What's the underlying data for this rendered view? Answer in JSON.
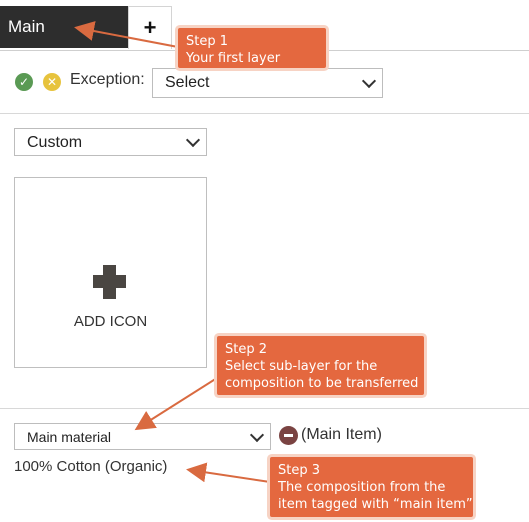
{
  "tabs": {
    "main_label": "Main",
    "add_label": "+"
  },
  "exception": {
    "label": "Exception:",
    "select_value": "Select"
  },
  "custom_select": {
    "value": "Custom"
  },
  "add_icon": {
    "label": "ADD ICON"
  },
  "material": {
    "select_value": "Main material",
    "main_item_label": "(Main Item)",
    "composition": "100% Cotton (Organic)"
  },
  "callouts": {
    "step1": {
      "title": "Step 1",
      "text": "Your first layer"
    },
    "step2": {
      "title": "Step 2",
      "line1": "Select sub-layer for the",
      "line2": "composition to be transferred"
    },
    "step3": {
      "title": "Step 3",
      "line1": "The composition from the",
      "line2": "item tagged with “main item”"
    }
  },
  "colors": {
    "tab_active": "#2d2d2d",
    "callout": "#e4683f",
    "ok": "#5a9a54",
    "cancel": "#e7c33d",
    "remove": "#7a4342"
  }
}
